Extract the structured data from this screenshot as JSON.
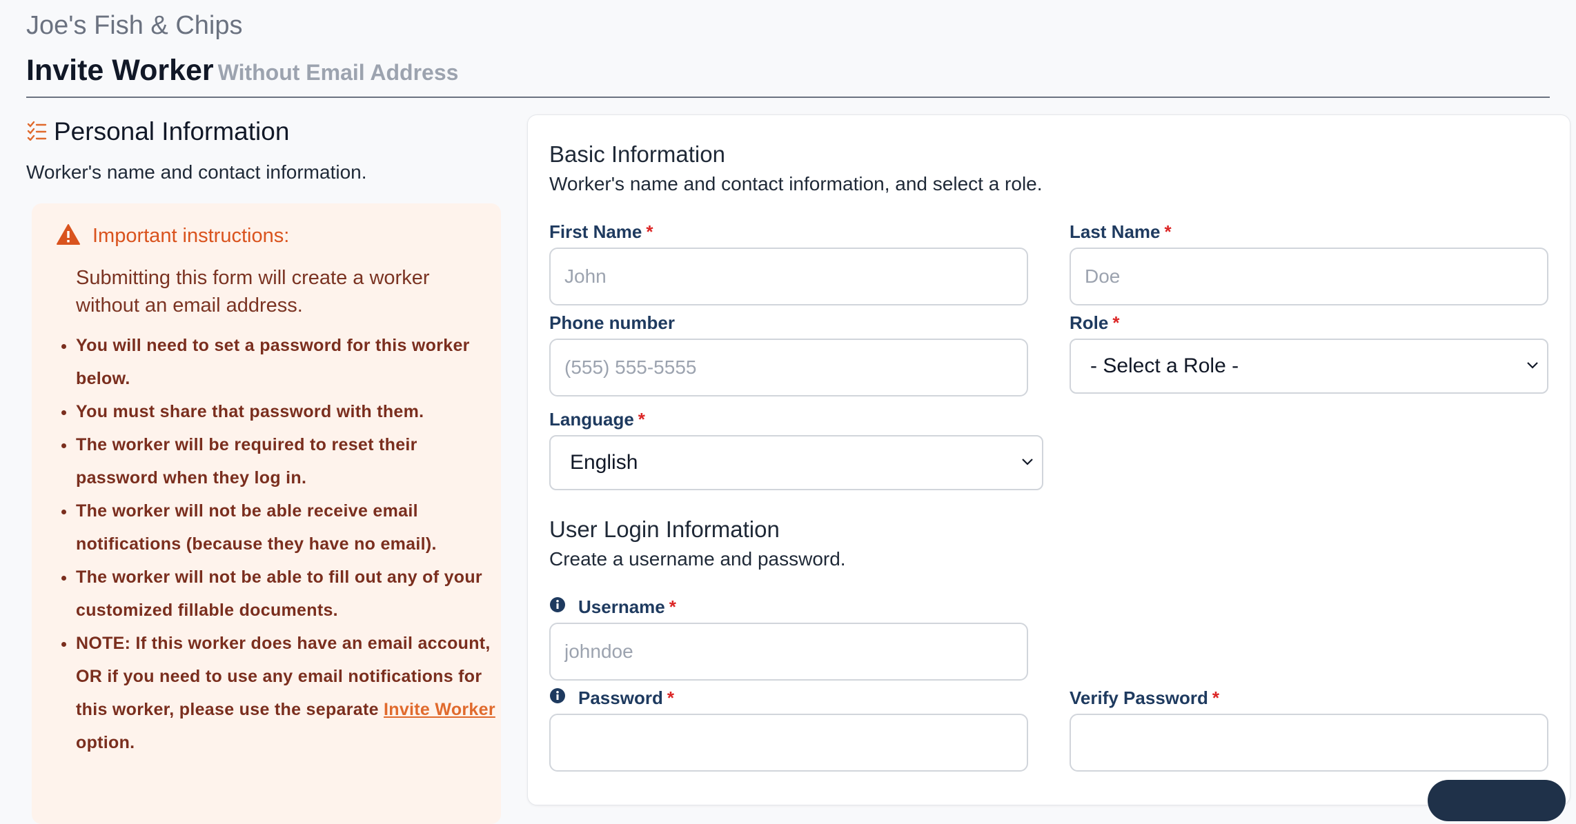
{
  "header": {
    "company": "Joe's Fish & Chips",
    "title": "Invite Worker",
    "subtitle": "Without Email Address"
  },
  "personal": {
    "title": "Personal Information",
    "description": "Worker's name and contact information.",
    "icon": "checklist-icon"
  },
  "alert": {
    "title": "Important instructions:",
    "icon": "warning-icon",
    "intro": "Submitting this form will create a worker without an email address.",
    "items": [
      "You will need to set a password for this worker below.",
      "You must share that password with them.",
      "The worker will be required to reset their password when they log in.",
      "The worker will not be able receive email notifications (because they have no email).",
      "The worker will not be able to fill out any of your customized fillable documents."
    ],
    "note_prefix": "NOTE: If this worker does have an email account, OR if you need to use any email notifications for this worker, please use the separate",
    "note_link": "Invite Worker",
    "note_suffix": "option."
  },
  "basic": {
    "title": "Basic Information",
    "description": "Worker's name and contact information, and select a role."
  },
  "fields": {
    "first_name": {
      "label": "First Name",
      "required": "*",
      "placeholder": "John"
    },
    "last_name": {
      "label": "Last Name",
      "required": "*",
      "placeholder": "Doe"
    },
    "phone": {
      "label": "Phone number",
      "placeholder": "(555) 555-5555"
    },
    "role": {
      "label": "Role",
      "required": "*",
      "value": "- Select a Role -"
    },
    "language": {
      "label": "Language",
      "required": "*",
      "value": "English"
    },
    "username": {
      "label": "Username",
      "required": "*",
      "placeholder": "johndoe"
    },
    "password": {
      "label": "Password",
      "required": "*"
    },
    "verify_password": {
      "label": "Verify Password",
      "required": "*"
    }
  },
  "login": {
    "title": "User Login Information",
    "description": "Create a username and password."
  },
  "colors": {
    "accent_orange": "#d9531e",
    "alert_bg": "#fef3ec",
    "label_navy": "#1e3a5f",
    "required_red": "#dc2626"
  }
}
